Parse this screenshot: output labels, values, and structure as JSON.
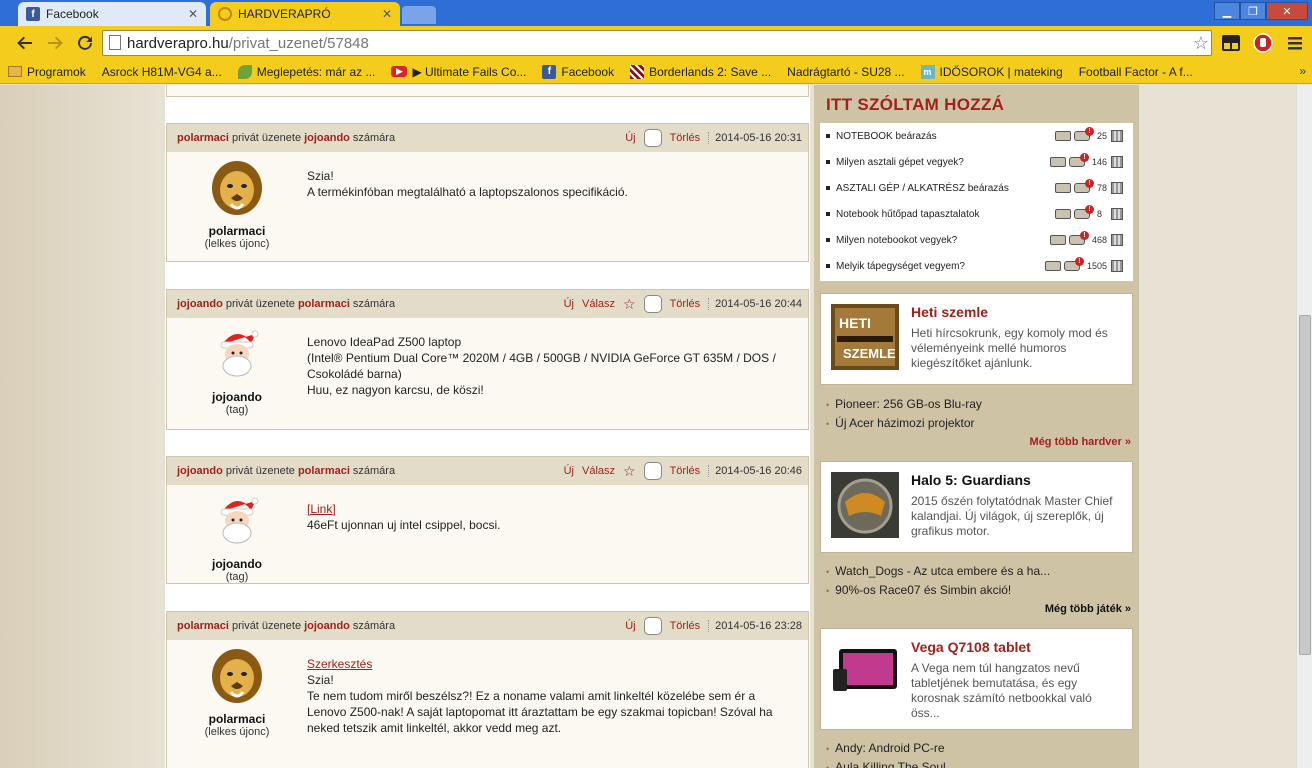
{
  "browser": {
    "tabs": [
      {
        "title": "Facebook",
        "active": false
      },
      {
        "title": "HARDVERAPRÓ",
        "active": true
      }
    ],
    "url_host": "hardverapro.hu",
    "url_path": "/privat_uzenet/57848",
    "bookmarks": [
      {
        "label": "Programok",
        "icon": "folder-icon"
      },
      {
        "label": "Asrock H81M-VG4 a...",
        "icon": "page-icon"
      },
      {
        "label": "Meglepetés: már az ...",
        "icon": "leaf-icon"
      },
      {
        "label": "▶ Ultimate Fails Co...",
        "icon": "youtube-icon"
      },
      {
        "label": "Facebook",
        "icon": "facebook-icon"
      },
      {
        "label": "Borderlands 2: Save ...",
        "icon": "borderlands-icon"
      },
      {
        "label": "Nadrágtartó - SU28 ...",
        "icon": "page-icon"
      },
      {
        "label": "IDŐSOROK | mateking",
        "icon": "mateking-icon"
      },
      {
        "label": "Football Factor - A f...",
        "icon": "page-icon"
      }
    ],
    "bookmarks_more": "»"
  },
  "messages_common": {
    "private_msg": "privát üzenete",
    "for": "számára",
    "new": "Új",
    "reply": "Válasz",
    "delete": "Törlés"
  },
  "messages": [
    {
      "from": "polarmaci",
      "to": "jojoando",
      "date": "2014-05-16 20:31",
      "author_name": "polarmaci",
      "author_rank": "(lelkes újonc)",
      "lines": [
        "Szia!",
        "A termékinfóban megtalálható a laptopszalonos specifikáció."
      ]
    },
    {
      "from": "jojoando",
      "to": "polarmaci",
      "date": "2014-05-16 20:44",
      "author_name": "jojoando",
      "author_rank": "(tag)",
      "lines": [
        "Lenovo IdeaPad Z500 laptop",
        "(Intel® Pentium Dual Core™ 2020M / 4GB / 500GB / NVIDIA GeForce GT 635M / DOS /",
        "Csokoládé barna)",
        "Huu, ez nagyon karcsu, de köszi!"
      ]
    },
    {
      "from": "jojoando",
      "to": "polarmaci",
      "date": "2014-05-16 20:46",
      "author_name": "jojoando",
      "author_rank": "(tag)",
      "link": "[Link]",
      "lines": [
        "46eFt ujonnan uj intel csippel, bocsi."
      ]
    },
    {
      "from": "polarmaci",
      "to": "jojoando",
      "date": "2014-05-16 23:28",
      "author_name": "polarmaci",
      "author_rank": "(lelkes újonc)",
      "link": "Szerkesztés",
      "lines": [
        "Szia!",
        "Te nem tudom miről beszélsz?! Ez a noname valami amit linkeltél közelébe sem ér a",
        "Lenovo Z500-nak! A saját laptopomat itt áraztattam be egy szakmai topicban! Szóval ha",
        "neked tetszik amit linkeltél, akkor vedd meg azt."
      ]
    }
  ],
  "sidebar": {
    "header": "ITT SZÓLTAM HOZZÁ",
    "topics": [
      {
        "title": "NOTEBOOK beárazás",
        "count": "25"
      },
      {
        "title": "Milyen asztali gépet vegyek?",
        "count": "146"
      },
      {
        "title": "ASZTALI GÉP / ALKATRÉSZ beárazás",
        "count": "78"
      },
      {
        "title": "Notebook hűtőpad tapasztalatok",
        "count": "8"
      },
      {
        "title": "Milyen notebookot vegyek?",
        "count": "468"
      },
      {
        "title": "Melyik tápegységet vegyem?",
        "count": "1505"
      }
    ],
    "card1": {
      "title": "Heti szemle",
      "desc": "Heti hírcsokrunk, egy komoly mod és véleményeink mellé humoros kiegészítőket ajánlunk.",
      "thumb_line1": "HETI",
      "thumb_line2": "SZEMLE"
    },
    "links1": [
      "Pioneer: 256 GB-os Blu-ray",
      "Új Acer házimozi projektor"
    ],
    "more1": "Még több hardver »",
    "card2": {
      "title": "Halo 5: Guardians",
      "desc": "2015 őszén folytatódnak Master Chief kalandjai. Új világok, új szereplők, új grafikus motor."
    },
    "links2": [
      "Watch_Dogs - Az utca embere és a ha...",
      "90%-os Race07 és Simbin akció!"
    ],
    "more2": "Még több játék »",
    "card3": {
      "title": "Vega Q7108 tablet",
      "desc": "A Vega nem túl hangzatos nevű tabletjének bemutatása, és egy korosnak számító netbookkal való öss..."
    },
    "links3": [
      "Andy: Android PC-re",
      "Aula Killing The Soul"
    ]
  },
  "colors": {
    "brand_red": "#a0221c",
    "chrome_yellow": "#f4cc1c",
    "titlebar_blue": "#2f6ed6"
  }
}
